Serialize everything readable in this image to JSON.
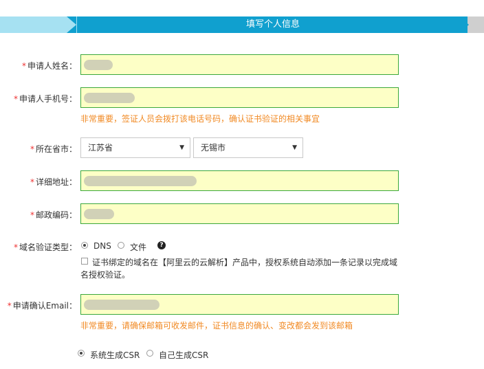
{
  "step": {
    "title": "填写个人信息"
  },
  "form": {
    "required_mark": "*",
    "name_label": "申请人姓名：",
    "phone_label": "申请人手机号：",
    "phone_hint": "非常重要，签证人员会拨打该电话号码，确认证书验证的相关事宜",
    "province_label": "所在省市：",
    "province_value": "江苏省",
    "city_value": "无锡市",
    "address_label": "详细地址：",
    "zip_label": "邮政编码：",
    "domain_verify_label": "域名验证类型：",
    "dns_option": "DNS",
    "file_option": "文件",
    "help_glyph": "?",
    "checkbox_line1": "证书绑定的域名在【阿里云的云解析】产品中，授权系统自动添加一条记录以完成域",
    "checkbox_line2": "名授权验证。",
    "email_label": "申请确认Email：",
    "email_hint": "非常重要，请确保邮箱可收发邮件，证书信息的确认、变改都会发到该邮箱",
    "csr_option_system": "系统生成CSR",
    "csr_option_self": "自己生成CSR",
    "select_arrow": "▼"
  },
  "colors": {
    "accent": "#10a0cf",
    "step_done": "#a6e1f2",
    "step_pending": "#cfcfcf",
    "field_bg": "#fdffc6",
    "field_border": "#3aa83a",
    "hint": "#f18a24",
    "required": "#e33333"
  }
}
